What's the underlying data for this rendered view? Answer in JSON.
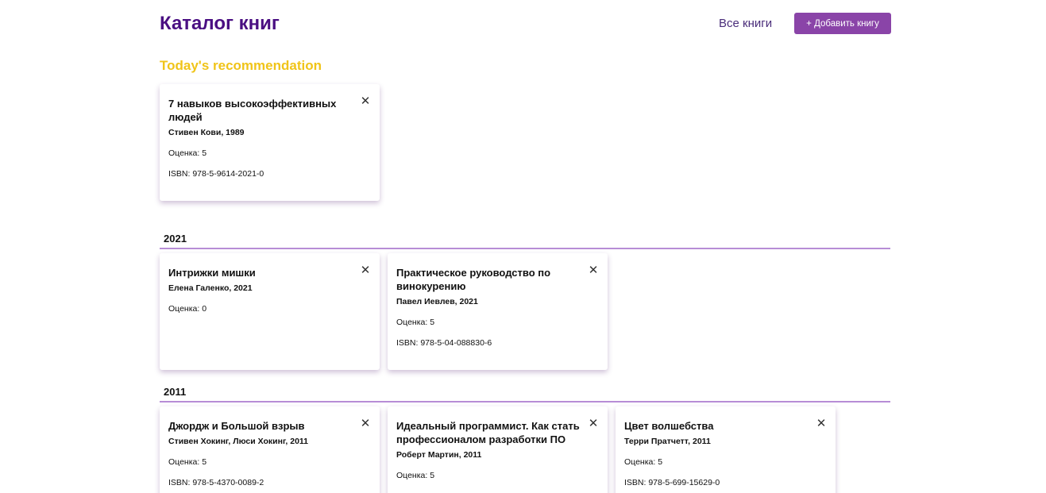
{
  "header": {
    "title": "Каталог книг",
    "nav_all_books": "Все книги",
    "add_button": "+ Добавить книгу"
  },
  "recommendation": {
    "title": "Today's recommendation",
    "book": {
      "title": "7 навыков высокоэффективных людей",
      "author": "Стивен Кови, 1989",
      "rating": "Оценка: 5",
      "isbn": "ISBN: 978-5-9614-2021-0"
    }
  },
  "groups": [
    {
      "year": "2021",
      "books": [
        {
          "title": "Интрижки мишки",
          "author": "Елена Галенко, 2021",
          "rating": "Оценка: 0"
        },
        {
          "title": "Практическое руководство по винокурению",
          "author": "Павел Иевлев, 2021",
          "rating": "Оценка: 5",
          "isbn": "ISBN: 978-5-04-088830-6"
        }
      ]
    },
    {
      "year": "2011",
      "books": [
        {
          "title": "Джордж и Большой взрыв",
          "author": "Стивен Хокинг, Люси Хокинг, 2011",
          "rating": "Оценка: 5",
          "isbn": "ISBN: 978-5-4370-0089-2"
        },
        {
          "title": "Идеальный программист. Как стать профессионалом разработки ПО",
          "author": "Роберт Мартин, 2011",
          "rating": "Оценка: 5"
        },
        {
          "title": "Цвет волшебства",
          "author": "Терри Пратчетт, 2011",
          "rating": "Оценка: 5",
          "isbn": "ISBN: 978-5-699-15629-0"
        }
      ]
    }
  ],
  "icons": {
    "close": "✕"
  },
  "colors": {
    "title": "#4a0f82",
    "accent_button": "#8a44a8",
    "recommendation": "#f0c419",
    "divider": "#b78dd6"
  }
}
